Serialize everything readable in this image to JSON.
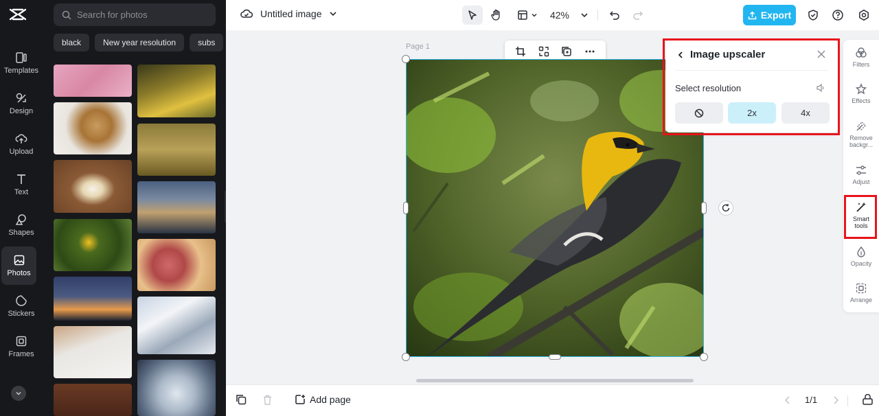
{
  "app": {
    "brand": "CapCut",
    "document_title": "Untitled image",
    "zoom": "42%",
    "export_label": "Export"
  },
  "rail": {
    "items": [
      {
        "label": "Templates",
        "icon": "templates-icon"
      },
      {
        "label": "Design",
        "icon": "design-icon"
      },
      {
        "label": "Upload",
        "icon": "upload-icon"
      },
      {
        "label": "Text",
        "icon": "text-icon"
      },
      {
        "label": "Shapes",
        "icon": "shapes-icon"
      },
      {
        "label": "Photos",
        "icon": "photos-icon",
        "active": true
      },
      {
        "label": "Stickers",
        "icon": "stickers-icon"
      },
      {
        "label": "Frames",
        "icon": "frames-icon"
      }
    ]
  },
  "photos_panel": {
    "search_placeholder": "Search for photos",
    "chips": [
      "black",
      "New year resolution",
      "subs"
    ]
  },
  "canvas": {
    "page_label": "Page 1"
  },
  "upscaler": {
    "title": "Image upscaler",
    "select_label": "Select resolution",
    "options": [
      "",
      "2x",
      "4x"
    ],
    "selected": "2x"
  },
  "right_rail": {
    "items": [
      {
        "label": "Filters",
        "icon": "filters-icon"
      },
      {
        "label": "Effects",
        "icon": "effects-icon"
      },
      {
        "label": "Remove backgr...",
        "icon": "remove-background-icon"
      },
      {
        "label": "Adjust",
        "icon": "adjust-icon"
      },
      {
        "label": "Smart tools",
        "icon": "smart-tools-icon",
        "active": true
      },
      {
        "label": "Opacity",
        "icon": "opacity-icon"
      },
      {
        "label": "Arrange",
        "icon": "arrange-icon"
      }
    ]
  },
  "bottom": {
    "add_page_label": "Add page",
    "pager": "1/1"
  },
  "colors": {
    "accent": "#22b6f0",
    "highlight": "#e8131c",
    "selected_option": "#ccf0fa"
  }
}
